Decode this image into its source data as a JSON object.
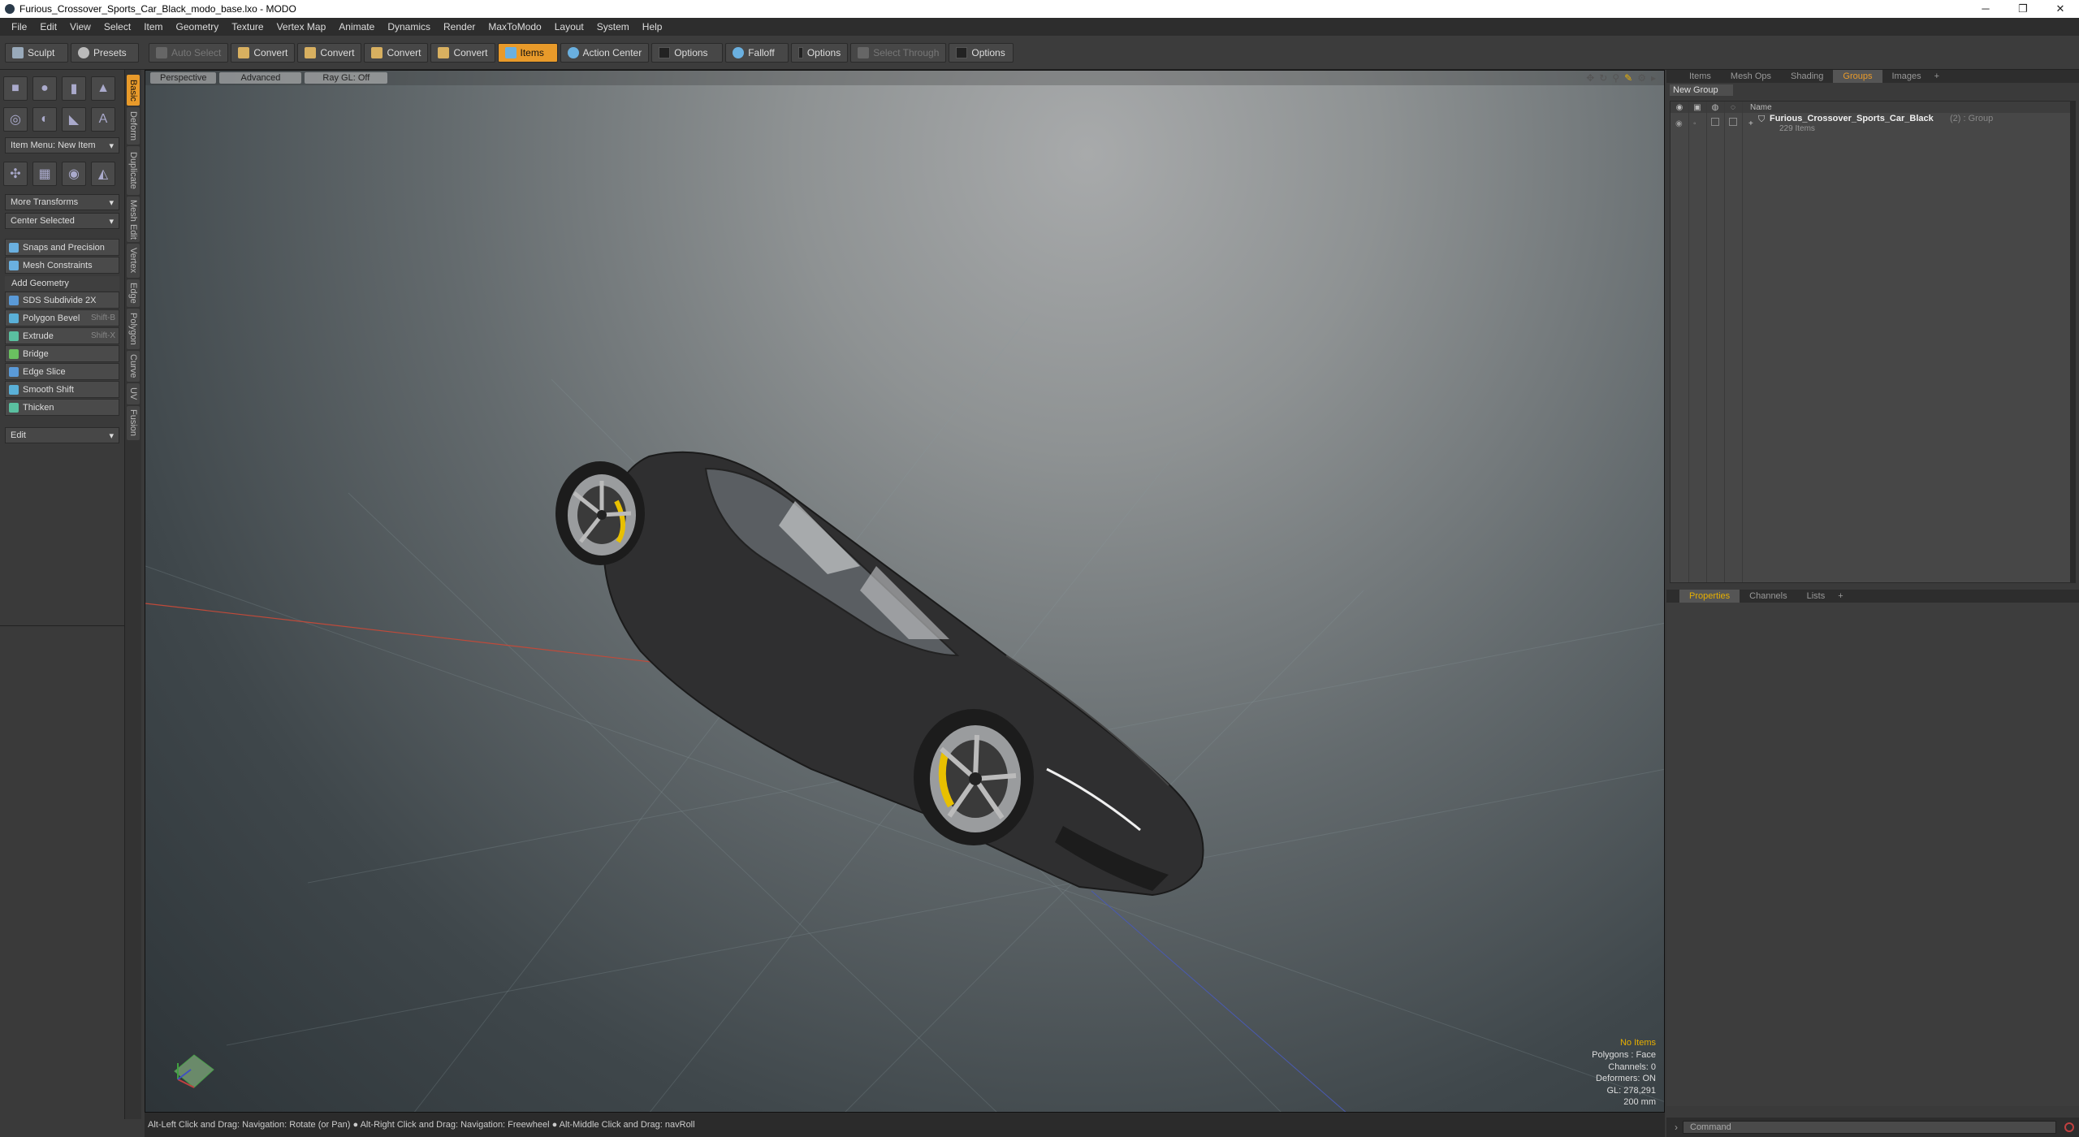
{
  "window": {
    "title": "Furious_Crossover_Sports_Car_Black_modo_base.lxo - MODO",
    "minimize": "─",
    "maximize": "❐",
    "close": "✕"
  },
  "menu": [
    "File",
    "Edit",
    "View",
    "Select",
    "Item",
    "Geometry",
    "Texture",
    "Vertex Map",
    "Animate",
    "Dynamics",
    "Render",
    "MaxToModo",
    "Layout",
    "System",
    "Help"
  ],
  "toolbar": {
    "sculpt": "Sculpt",
    "presets": "Presets",
    "auto_select": "Auto Select",
    "convert1": "Convert",
    "convert2": "Convert",
    "convert3": "Convert",
    "convert4": "Convert",
    "items": "Items",
    "action_center": "Action Center",
    "options1": "Options",
    "falloff": "Falloff",
    "options2": "Options",
    "select_through": "Select Through",
    "options3": "Options"
  },
  "left": {
    "item_menu": "Item Menu: New Item",
    "more_transforms": "More Transforms",
    "center_selected": "Center Selected",
    "snaps": "Snaps and Precision",
    "mesh_constraints": "Mesh Constraints",
    "add_geometry": "Add Geometry",
    "tools": [
      {
        "label": "SDS Subdivide 2X",
        "shortcut": "",
        "color": "#5a9ad8"
      },
      {
        "label": "Polygon Bevel",
        "shortcut": "Shift-B",
        "color": "#5ab0d8"
      },
      {
        "label": "Extrude",
        "shortcut": "Shift-X",
        "color": "#5ac0a0"
      },
      {
        "label": "Bridge",
        "shortcut": "",
        "color": "#6ac060"
      },
      {
        "label": "Edge Slice",
        "shortcut": "",
        "color": "#5a9ad8"
      },
      {
        "label": "Smooth Shift",
        "shortcut": "",
        "color": "#5ab0d8"
      },
      {
        "label": "Thicken",
        "shortcut": "",
        "color": "#5ac0a0"
      }
    ],
    "edit": "Edit",
    "vtabs": [
      "Basic",
      "Deform",
      "Duplicate",
      "Mesh Edit",
      "Vertex",
      "Edge",
      "Polygon",
      "Curve",
      "UV",
      "Fusion"
    ]
  },
  "viewport": {
    "perspective": "Perspective",
    "advanced": "Advanced",
    "raygl": "Ray GL: Off",
    "stats": {
      "no_items": "No Items",
      "polygons": "Polygons : Face",
      "channels": "Channels: 0",
      "deformers": "Deformers: ON",
      "gl": "GL: 278,291",
      "scale": "200 mm"
    }
  },
  "status": "Alt-Left Click and Drag: Navigation: Rotate (or Pan) ● Alt-Right Click and Drag: Navigation: Freewheel ● Alt-Middle Click and Drag: navRoll",
  "right": {
    "tabs": [
      "Items",
      "Mesh Ops",
      "Shading",
      "Groups",
      "Images",
      "+"
    ],
    "new_group": "New Group",
    "col_name": "Name",
    "group_name": "Furious_Crossover_Sports_Car_Black",
    "group_suffix": "(2) : Group",
    "group_count": "229 Items",
    "prop_tabs": [
      "Properties",
      "Channels",
      "Lists",
      "+"
    ],
    "command_placeholder": "Command"
  }
}
